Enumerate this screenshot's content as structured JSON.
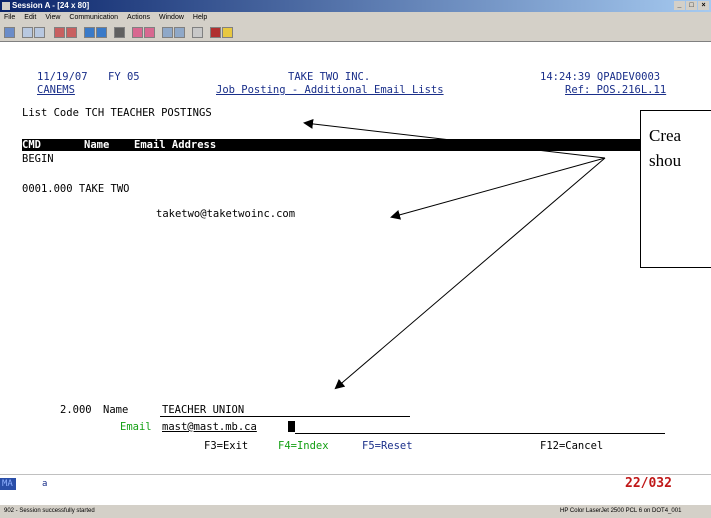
{
  "window": {
    "title": "Session A - [24 x 80]"
  },
  "menu": [
    "File",
    "Edit",
    "View",
    "Communication",
    "Actions",
    "Window",
    "Help"
  ],
  "screen": {
    "date": "11/19/07",
    "fy": "FY 05",
    "company": "TAKE TWO INC.",
    "time_sys": "14:24:39 QPADEV0003",
    "program": "CANEMS",
    "screen_title": "Job Posting - Additional Email Lists",
    "ref": "Ref: POS.216L.11",
    "list_code": "List Code TCH TEACHER POSTINGS",
    "header": {
      "cmd": "CMD",
      "name": "Name",
      "email": "Email Address"
    },
    "begin": "BEGIN",
    "entry_line": "0001.000 TAKE TWO",
    "entry_email": "taketwo@taketwoinc.com",
    "input_seq": "2.000",
    "name_label": "Name",
    "name_value": "TEACHER UNION",
    "email_label": "Email",
    "email_value": "mast@mast.mb.ca",
    "fkeys": {
      "f3": "F3=Exit",
      "f4": "F4=Index",
      "f5": "F5=Reset",
      "f12": "F12=Cancel"
    }
  },
  "callout": {
    "line1": "Crea",
    "line2": "shou"
  },
  "status": {
    "mode": "MA",
    "cursor_char": "a",
    "position": "22/032"
  },
  "bottom": {
    "session_msg": "902 - Session successfully started",
    "printer": "HP Color LaserJet 2500 PCL 6 on DOT4_001"
  }
}
